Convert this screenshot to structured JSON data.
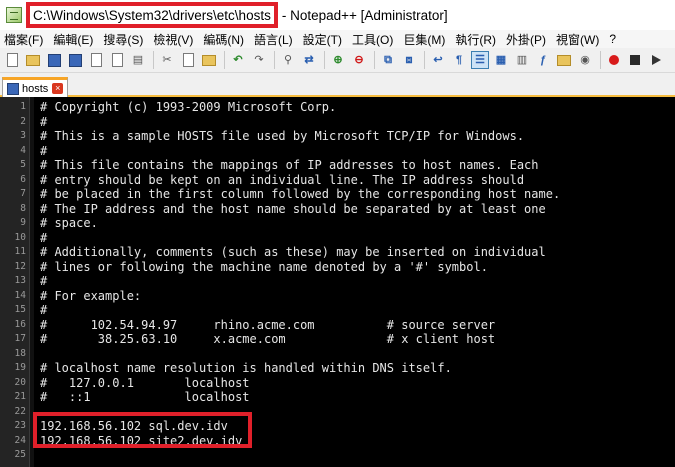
{
  "window": {
    "path": "C:\\Windows\\System32\\drivers\\etc\\hosts",
    "title_rest": "- Notepad++ [Administrator]"
  },
  "menu": [
    "檔案(F)",
    "編輯(E)",
    "搜尋(S)",
    "檢視(V)",
    "編碼(N)",
    "語言(L)",
    "設定(T)",
    "工具(O)",
    "巨集(M)",
    "執行(R)",
    "外掛(P)",
    "視窗(W)",
    "?"
  ],
  "tab": {
    "label": "hosts"
  },
  "lines": [
    "# Copyright (c) 1993-2009 Microsoft Corp.",
    "#",
    "# This is a sample HOSTS file used by Microsoft TCP/IP for Windows.",
    "#",
    "# This file contains the mappings of IP addresses to host names. Each",
    "# entry should be kept on an individual line. The IP address should",
    "# be placed in the first column followed by the corresponding host name.",
    "# The IP address and the host name should be separated by at least one",
    "# space.",
    "#",
    "# Additionally, comments (such as these) may be inserted on individual",
    "# lines or following the machine name denoted by a '#' symbol.",
    "#",
    "# For example:",
    "#",
    "#      102.54.94.97     rhino.acme.com          # source server",
    "#       38.25.63.10     x.acme.com              # x client host",
    "",
    "# localhost name resolution is handled within DNS itself.",
    "#   127.0.0.1       localhost",
    "#   ::1             localhost",
    "",
    "192.168.56.102 sql.dev.idv",
    "192.168.56.102 site2.dev.idv",
    ""
  ],
  "line_numbers": [
    "1",
    "2",
    "3",
    "4",
    "5",
    "6",
    "7",
    "8",
    "9",
    "10",
    "11",
    "12",
    "13",
    "14",
    "15",
    "16",
    "17",
    "18",
    "19",
    "20",
    "21",
    "22",
    "23",
    "24",
    "25"
  ],
  "colors": {
    "highlight": "#e0202a",
    "editor_bg": "#000000",
    "text": "#e6e6e6"
  }
}
